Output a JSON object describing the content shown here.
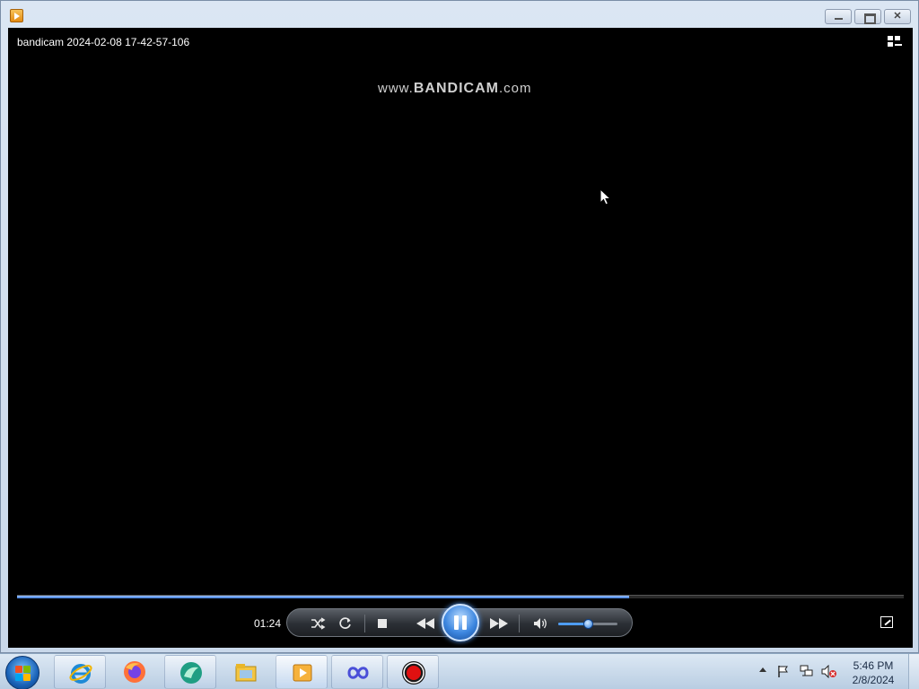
{
  "window": {
    "close_glyph": "✕",
    "caption_buttons": [
      "minimize",
      "restore",
      "close"
    ]
  },
  "player": {
    "video_title": "bandicam 2024-02-08 17-42-57-106",
    "watermark_prefix": "www.",
    "watermark_brand": "BANDICAM",
    "watermark_suffix": ".com",
    "elapsed_time": "01:24",
    "seek_progress": 0.69,
    "volume_level": 0.5,
    "state": "playing"
  },
  "taskbar": {
    "items": [
      {
        "name": "internet-explorer",
        "pinned": true
      },
      {
        "name": "firefox",
        "pinned": false
      },
      {
        "name": "green-app",
        "pinned": true
      },
      {
        "name": "file-explorer",
        "pinned": false
      },
      {
        "name": "media-player",
        "pinned": true
      },
      {
        "name": "infinity-app",
        "pinned": true
      },
      {
        "name": "bandicam-record",
        "pinned": true
      }
    ],
    "clock_time": "5:46 PM",
    "clock_date": "2/8/2024"
  },
  "colors": {
    "accent_blue": "#3d87e0",
    "record_red": "#e01010",
    "player_bg": "#000000"
  }
}
